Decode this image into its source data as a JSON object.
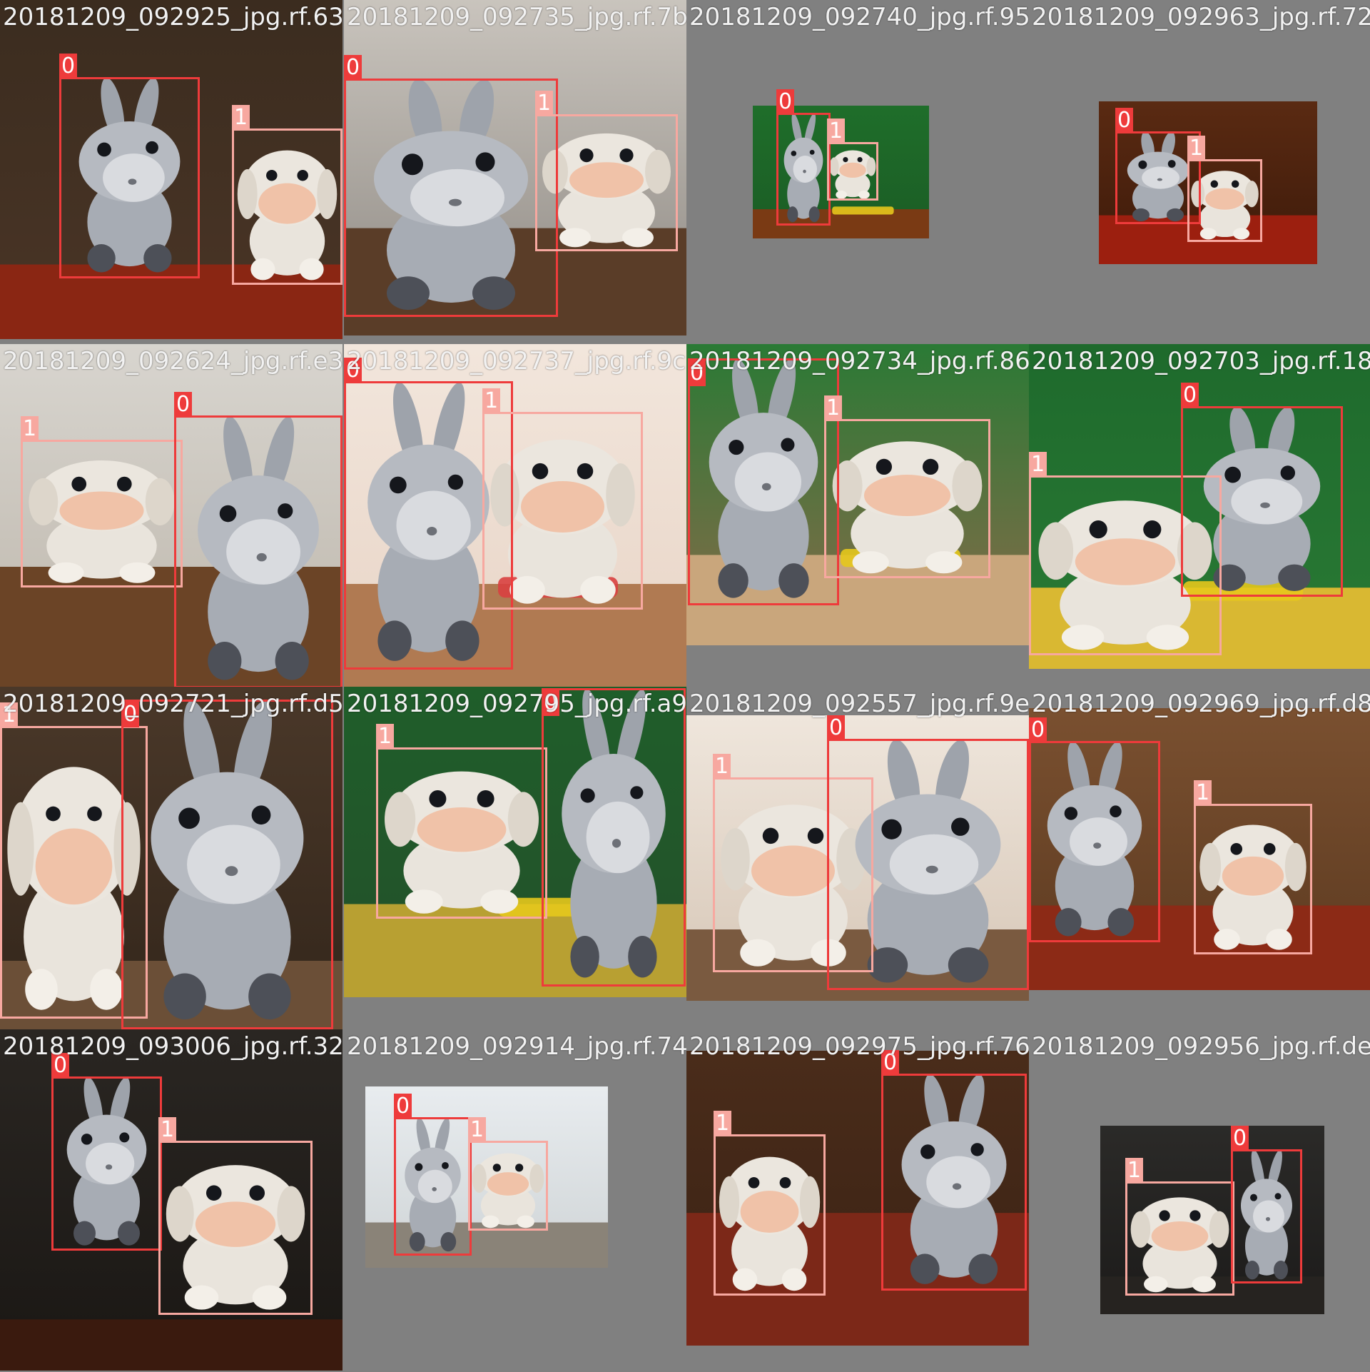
{
  "colors": {
    "class_0": "#ee3b3b",
    "class_1": "#f7a8a0",
    "background": "#808080",
    "caption_text": "#f2f2f2"
  },
  "tiles": [
    {
      "caption": "20181209_092925_jpg.rf.63",
      "scene": "dark-room-red-carpet",
      "boxes": [
        {
          "cls": "0"
        },
        {
          "cls": "1"
        }
      ]
    },
    {
      "caption": "20181209_092735_jpg.rf.7b",
      "scene": "window-wood-floor",
      "boxes": [
        {
          "cls": "0"
        },
        {
          "cls": "1"
        }
      ]
    },
    {
      "caption": "20181209_092740_jpg.rf.95",
      "scene": "green-wall-small",
      "boxes": [
        {
          "cls": "0"
        },
        {
          "cls": "1"
        }
      ]
    },
    {
      "caption": "20181209_092963_jpg.rf.72",
      "scene": "red-carpet-small",
      "boxes": [
        {
          "cls": "0"
        },
        {
          "cls": "1"
        }
      ]
    },
    {
      "caption": "20181209_092624_jpg.rf.e3",
      "scene": "curtain-wood-floor",
      "boxes": [
        {
          "cls": "1"
        },
        {
          "cls": "0"
        }
      ]
    },
    {
      "caption": "20181209_092737_jpg.rf.9c",
      "scene": "bright-room-rack",
      "boxes": [
        {
          "cls": "0"
        },
        {
          "cls": "1"
        }
      ]
    },
    {
      "caption": "20181209_092734_jpg.rf.86",
      "scene": "green-wall-dumbbells",
      "boxes": [
        {
          "cls": "0"
        },
        {
          "cls": "1"
        }
      ]
    },
    {
      "caption": "20181209_092703_jpg.rf.18",
      "scene": "green-wall-dumbbells-close",
      "boxes": [
        {
          "cls": "1"
        },
        {
          "cls": "0"
        }
      ]
    },
    {
      "caption": "20181209_092721_jpg.rf.d5",
      "scene": "close-up-dark",
      "boxes": [
        {
          "cls": "1"
        },
        {
          "cls": "0"
        }
      ]
    },
    {
      "caption": "20181209_092795_jpg.rf.a9",
      "scene": "green-wall-dumbbells-side",
      "boxes": [
        {
          "cls": "1"
        },
        {
          "cls": "0"
        }
      ]
    },
    {
      "caption": "20181209_092557_jpg.rf.9e",
      "scene": "bright-rack-close",
      "boxes": [
        {
          "cls": "1"
        },
        {
          "cls": "0"
        }
      ]
    },
    {
      "caption": "20181209_092969_jpg.rf.d8",
      "scene": "wood-wall-red-carpet",
      "boxes": [
        {
          "cls": "0"
        },
        {
          "cls": "1"
        }
      ]
    },
    {
      "caption": "20181209_093006_jpg.rf.32",
      "scene": "dark-door",
      "boxes": [
        {
          "cls": "0"
        },
        {
          "cls": "1"
        }
      ]
    },
    {
      "caption": "20181209_092914_jpg.rf.74",
      "scene": "bright-window-small",
      "boxes": [
        {
          "cls": "0"
        },
        {
          "cls": "1"
        }
      ]
    },
    {
      "caption": "20181209_092975_jpg.rf.76",
      "scene": "wood-floor-red",
      "boxes": [
        {
          "cls": "1"
        },
        {
          "cls": "0"
        }
      ]
    },
    {
      "caption": "20181209_092956_jpg.rf.de",
      "scene": "very-dark-small",
      "boxes": [
        {
          "cls": "1"
        },
        {
          "cls": "0"
        }
      ]
    }
  ]
}
